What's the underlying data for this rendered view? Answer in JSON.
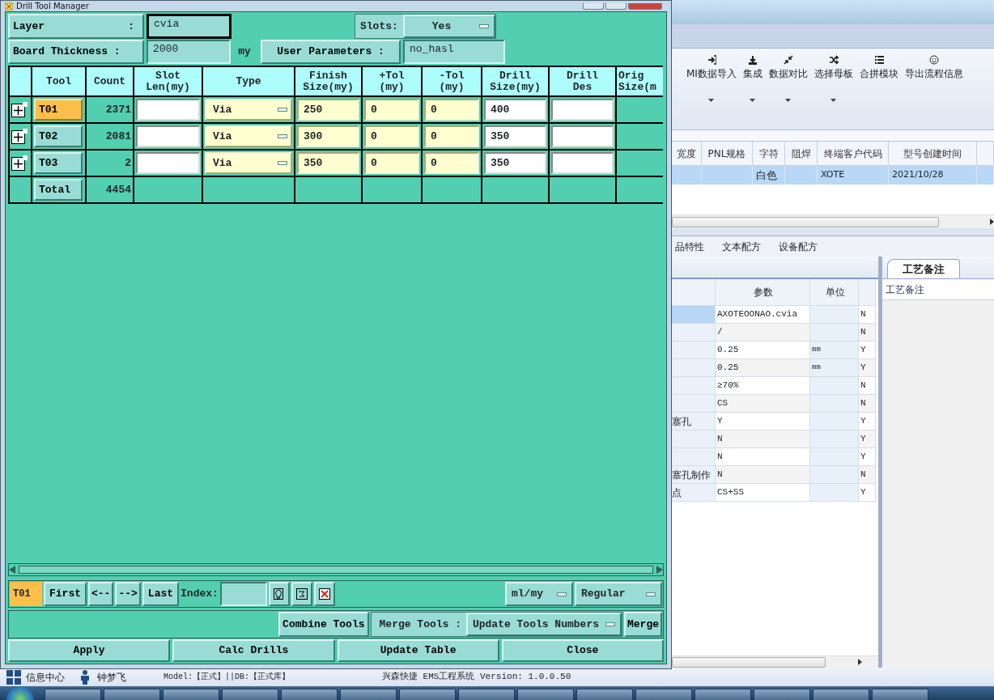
{
  "dialog": {
    "title": "Drill Tool Manager",
    "layer": {
      "label": "Layer",
      "separator": ":",
      "value": "cvia"
    },
    "slots": {
      "label": "Slots:",
      "value": "Yes"
    },
    "board_thickness": {
      "label": "Board Thickness :",
      "value": "2000",
      "unit": "my"
    },
    "user_parameters": {
      "label": "User Parameters :",
      "value": "no_hasl"
    },
    "table": {
      "columns": [
        {
          "lines": [
            "Tool"
          ]
        },
        {
          "lines": [
            "Count"
          ]
        },
        {
          "lines": [
            "Slot",
            "Len(my)"
          ]
        },
        {
          "lines": [
            "Type"
          ]
        },
        {
          "lines": [
            "Finish",
            "Size(my)"
          ]
        },
        {
          "lines": [
            "+Tol",
            "(my)"
          ]
        },
        {
          "lines": [
            "-Tol",
            "(my)"
          ]
        },
        {
          "lines": [
            "Drill",
            "Size(my)"
          ]
        },
        {
          "lines": [
            "Drill",
            "Des"
          ]
        },
        {
          "lines": [
            "Orig",
            "Size(m"
          ]
        }
      ],
      "rows": [
        {
          "tool": "T01",
          "selected": true,
          "count": "2371",
          "type": "Via",
          "finish_size": "250",
          "plus_tol": "0",
          "minus_tol": "0",
          "drill_size": "400"
        },
        {
          "tool": "T02",
          "selected": false,
          "count": "2081",
          "type": "Via",
          "finish_size": "300",
          "plus_tol": "0",
          "minus_tol": "0",
          "drill_size": "350"
        },
        {
          "tool": "T03",
          "selected": false,
          "count": "2",
          "type": "Via",
          "finish_size": "350",
          "plus_tol": "0",
          "minus_tol": "0",
          "drill_size": "350"
        }
      ],
      "total": {
        "label": "Total",
        "count": "4454"
      }
    },
    "nav": {
      "current_tool": "T01",
      "buttons": [
        "First",
        "<--",
        "-->",
        "Last"
      ],
      "index_label": "Index:",
      "unit_select": "ml/my",
      "mode_select": "Regular"
    },
    "merge": {
      "combine_button": "Combine Tools",
      "label": "Merge Tools :",
      "select": "Update Tools Numbers",
      "merge_button": "Merge"
    },
    "actions": [
      "Apply",
      "Calc Drills",
      "Update Table",
      "Close"
    ]
  },
  "app": {
    "toolbar": [
      {
        "label": "MI数据导入",
        "has_menu": true
      },
      {
        "label": "集成",
        "has_menu": true
      },
      {
        "label": "数据对比",
        "has_menu": true
      },
      {
        "label": "选择母板",
        "has_menu": true
      },
      {
        "label": "合拼模块",
        "has_menu": false
      },
      {
        "label": "导出流程信息",
        "has_menu": false
      }
    ],
    "grid": {
      "columns": [
        "宽度",
        "PNL规格",
        "字符",
        "阻焊",
        "终端客户代码",
        "型号创建时间"
      ],
      "rows": [
        {
          "selected": true,
          "cells": [
            null,
            null,
            "白色",
            null,
            "XOTE",
            "2021/10/28"
          ]
        }
      ]
    },
    "tabs": [
      "品特性",
      "文本配方",
      "设备配方"
    ],
    "params": {
      "columns": [
        "参数",
        "单位"
      ],
      "rows": [
        {
          "selected": true,
          "value": "AXOTEOONAO.cvia",
          "flag": "N"
        },
        {
          "selected": false,
          "value": "/",
          "flag": "N"
        },
        {
          "selected": false,
          "value": "0.25",
          "unit": "mm",
          "flag": "Y"
        },
        {
          "selected": false,
          "value": "0.25",
          "unit": "mm",
          "flag": "Y"
        },
        {
          "selected": false,
          "value": "≥70%",
          "flag": "N"
        },
        {
          "selected": false,
          "value": "CS",
          "flag": "N"
        },
        {
          "selected": false,
          "name": "塞孔",
          "value": "Y",
          "flag": "Y"
        },
        {
          "selected": false,
          "value": "N",
          "flag": "Y"
        },
        {
          "selected": false,
          "value": "N",
          "flag": "Y"
        },
        {
          "selected": false,
          "name": "塞孔制作",
          "value": "N",
          "flag": "N"
        },
        {
          "selected": false,
          "name": "点",
          "value": "CS+SS",
          "flag": "Y"
        }
      ]
    },
    "notes": {
      "tab": "工艺备注",
      "heading": "工艺备注"
    },
    "status_bar": {
      "items": [
        {
          "kind": "messages",
          "label": "信息中心"
        },
        {
          "kind": "user",
          "label": "钟梦飞"
        }
      ],
      "environment": "Model:【正式】||DB:【正式库】",
      "app_version": "兴森快捷 EMS工程系统 Version: 1.0.0.50"
    }
  }
}
